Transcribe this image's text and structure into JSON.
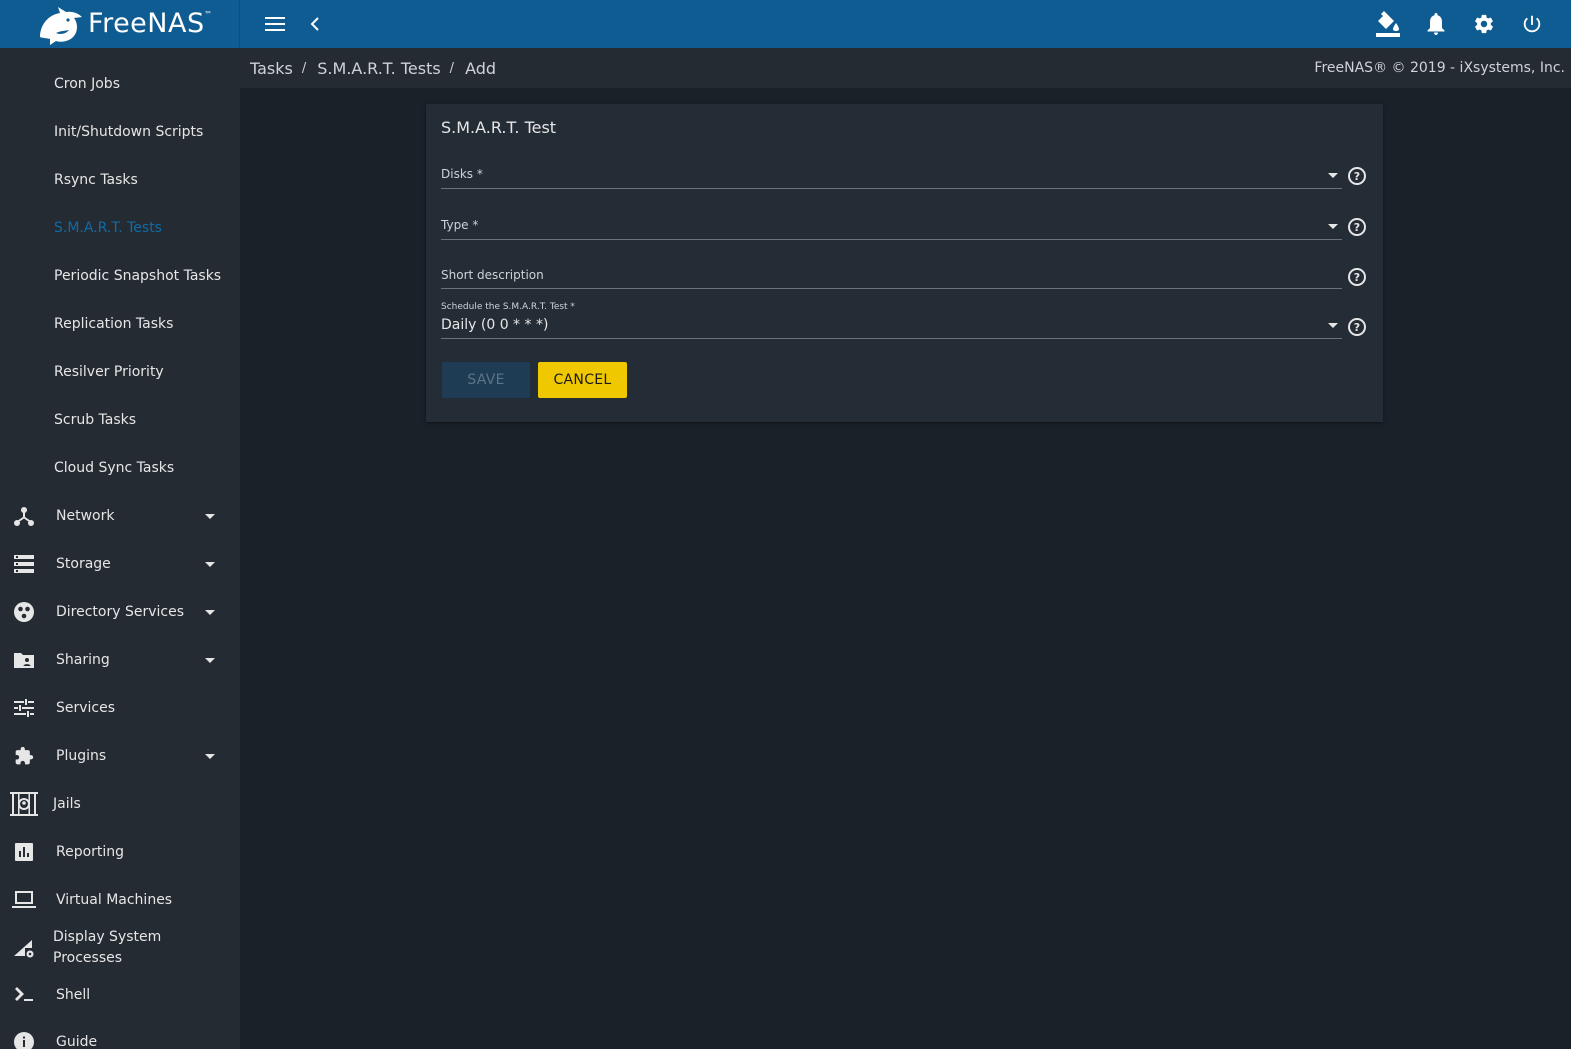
{
  "topbar": {
    "brand_text": "FreeNAS",
    "brand_tm": "™",
    "icons": [
      "menu-icon",
      "chevron-left-icon",
      "paint-bucket-icon",
      "bell-icon",
      "gear-icon",
      "power-icon"
    ]
  },
  "breadcrumb": {
    "items": [
      "Tasks",
      "S.M.A.R.T. Tests",
      "Add"
    ],
    "separator": "/"
  },
  "copyright": "FreeNAS® © 2019 - iXsystems, Inc.",
  "sidebar": {
    "sub_items": [
      {
        "label": "Cron Jobs"
      },
      {
        "label": "Init/Shutdown Scripts"
      },
      {
        "label": "Rsync Tasks"
      },
      {
        "label": "S.M.A.R.T. Tests",
        "active": true
      },
      {
        "label": "Periodic Snapshot Tasks"
      },
      {
        "label": "Replication Tasks"
      },
      {
        "label": "Resilver Priority"
      },
      {
        "label": "Scrub Tasks"
      },
      {
        "label": "Cloud Sync Tasks"
      }
    ],
    "items": [
      {
        "label": "Network",
        "icon": "network-icon",
        "expandable": true
      },
      {
        "label": "Storage",
        "icon": "storage-icon",
        "expandable": true
      },
      {
        "label": "Directory Services",
        "icon": "directory-services-icon",
        "expandable": true
      },
      {
        "label": "Sharing",
        "icon": "sharing-folder-icon",
        "expandable": true
      },
      {
        "label": "Services",
        "icon": "services-sliders-icon",
        "expandable": false
      },
      {
        "label": "Plugins",
        "icon": "puzzle-icon",
        "expandable": true
      },
      {
        "label": "Jails",
        "icon": "jail-icon",
        "expandable": false
      },
      {
        "label": "Reporting",
        "icon": "bar-chart-icon",
        "expandable": false
      },
      {
        "label": "Virtual Machines",
        "icon": "laptop-icon",
        "expandable": false
      },
      {
        "label_line1": "Display System",
        "label_line2": "Processes",
        "icon": "processes-icon",
        "expandable": false
      },
      {
        "label": "Shell",
        "icon": "terminal-icon",
        "expandable": false
      },
      {
        "label": "Guide",
        "icon": "info-icon",
        "expandable": false
      }
    ]
  },
  "form": {
    "title": "S.M.A.R.T. Test",
    "disks": {
      "label": "Disks *",
      "value": ""
    },
    "type": {
      "label": "Type *",
      "value": ""
    },
    "description": {
      "label": "Short description",
      "value": ""
    },
    "schedule": {
      "label": "Schedule the S.M.A.R.T. Test *",
      "value": "Daily (0 0 * * *)"
    },
    "help_glyph": "?",
    "save_label": "SAVE",
    "cancel_label": "CANCEL"
  },
  "colors": {
    "topbar": "#0e5c91",
    "sidebar": "#252b33",
    "content_bg": "#1b2129",
    "card": "#242c35",
    "active_link": "#0e6ba8",
    "cancel_button": "#f0c800",
    "save_button_disabled": "#1e3c54"
  }
}
